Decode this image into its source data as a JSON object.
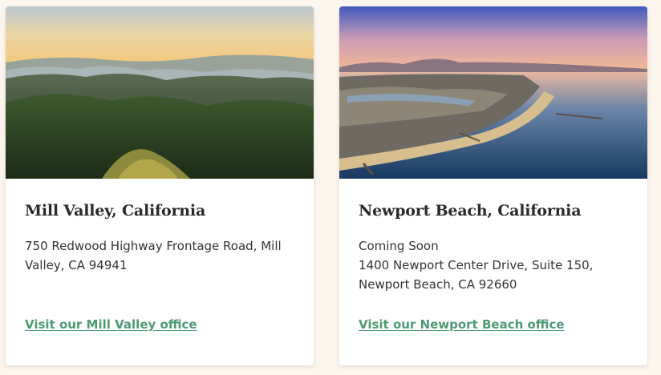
{
  "locations": [
    {
      "title": "Mill Valley, California",
      "address": "750 Redwood Highway Frontage Road, Mill Valley, CA 94941",
      "link_label": "Visit our Mill Valley office"
    },
    {
      "title": "Newport Beach, California",
      "status": "Coming Soon",
      "address_line1": "1400 Newport Center Drive, Suite 150,",
      "address_line2": "Newport Beach, CA 92660",
      "link_label": "Visit our Newport Beach office"
    }
  ],
  "colors": {
    "background": "#fdf6ef",
    "card": "#ffffff",
    "link": "#4e9a73",
    "title": "#2a2a2a"
  }
}
